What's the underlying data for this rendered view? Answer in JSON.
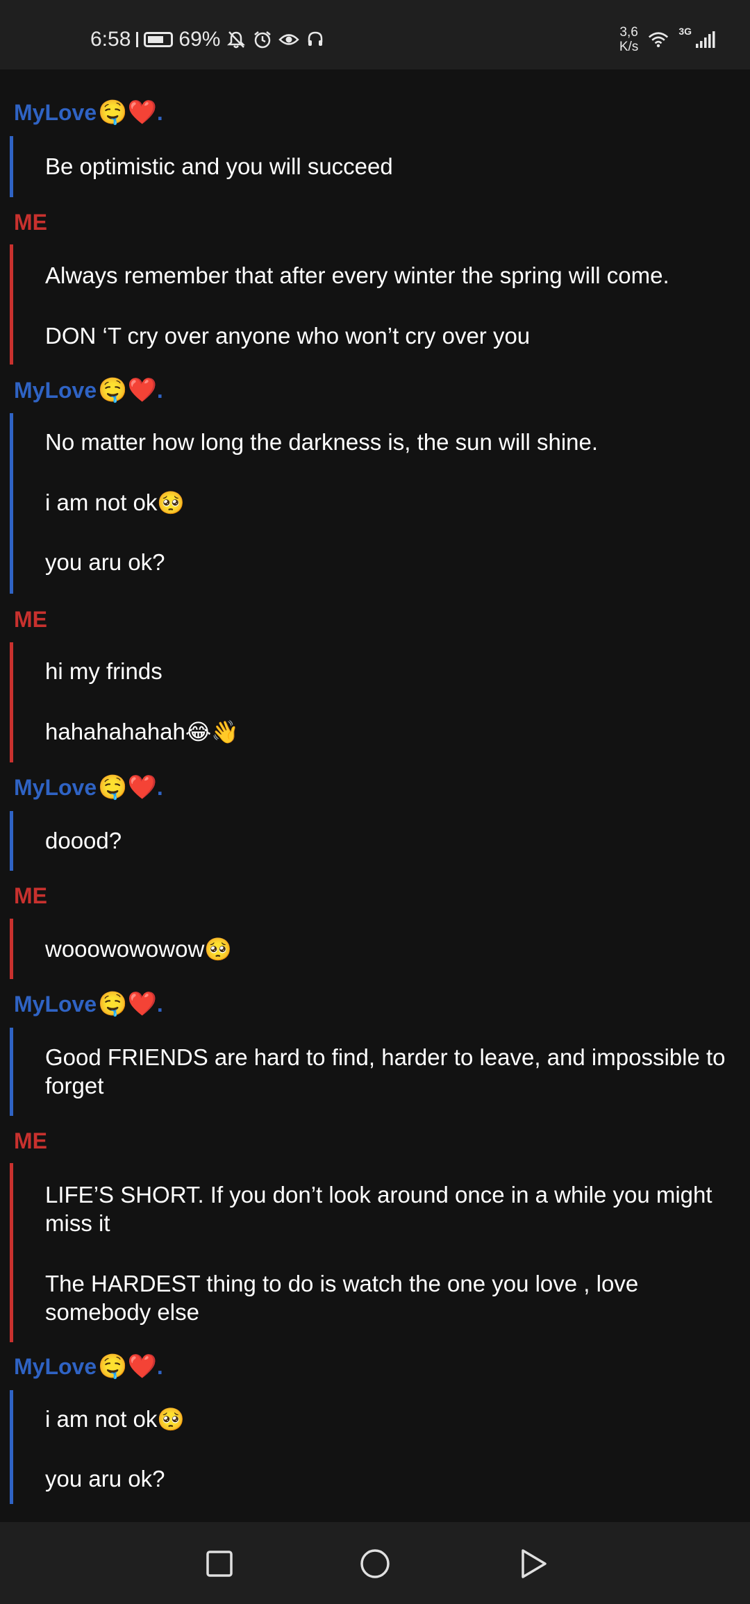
{
  "status_bar": {
    "time": "6:58",
    "battery": "69%",
    "speed_value": "3,6",
    "speed_unit": "K/s",
    "network": "3G",
    "icons": [
      "battery-icon",
      "mute-bell-icon",
      "alarm-icon",
      "eye-icon",
      "headset-icon",
      "wifi-icon",
      "signal-icon"
    ]
  },
  "colors": {
    "love": "#2f63c4",
    "me": "#c8312e",
    "background": "#121212"
  },
  "chat": {
    "groups": [
      {
        "sender": "MyLove",
        "sender_suffix": ".",
        "sender_emoji": "🤤❤️",
        "messages": [
          {
            "text": "Be optimistic and you will succeed",
            "emoji": ""
          }
        ]
      },
      {
        "sender": "ME",
        "messages": [
          {
            "text": "Always remember that after every winter the spring will come.",
            "emoji": ""
          },
          {
            "text": "DON ‘T cry over anyone who won’t cry over you",
            "emoji": ""
          }
        ]
      },
      {
        "sender": "MyLove",
        "sender_suffix": ".",
        "sender_emoji": "🤤❤️",
        "messages": [
          {
            "text": "No matter how long the darkness is, the sun will shine.",
            "emoji": ""
          },
          {
            "text": "i am not ok",
            "emoji": "🥺"
          },
          {
            "text": "you aru ok?",
            "emoji": ""
          }
        ]
      },
      {
        "sender": "ME",
        "messages": [
          {
            "text": "hi my frinds",
            "emoji": ""
          },
          {
            "text": "hahahahahah",
            "emoji": "😂👋"
          }
        ]
      },
      {
        "sender": "MyLove",
        "sender_suffix": ".",
        "sender_emoji": "🤤❤️",
        "messages": [
          {
            "text": "doood?",
            "emoji": ""
          }
        ]
      },
      {
        "sender": "ME",
        "messages": [
          {
            "text": "wooowowowow",
            "emoji": "🥺"
          }
        ]
      },
      {
        "sender": "MyLove",
        "sender_suffix": ".",
        "sender_emoji": "🤤❤️",
        "messages": [
          {
            "text": "Good FRIENDS are hard to find, harder to leave, and impossible to forget",
            "emoji": ""
          }
        ]
      },
      {
        "sender": "ME",
        "messages": [
          {
            "text": "LIFE’S SHORT. If you don’t look around once in a while you might miss it",
            "emoji": ""
          },
          {
            "text": "The HARDEST thing to do is watch the one you love , love somebody else",
            "emoji": ""
          }
        ]
      },
      {
        "sender": "MyLove",
        "sender_suffix": ".",
        "sender_emoji": "🤤❤️",
        "messages": [
          {
            "text": "i am not ok",
            "emoji": "🥺"
          },
          {
            "text": "you aru ok?",
            "emoji": ""
          }
        ]
      }
    ]
  },
  "nav_bar": {
    "buttons": [
      "recents-square-icon",
      "home-circle-icon",
      "back-triangle-icon"
    ]
  }
}
